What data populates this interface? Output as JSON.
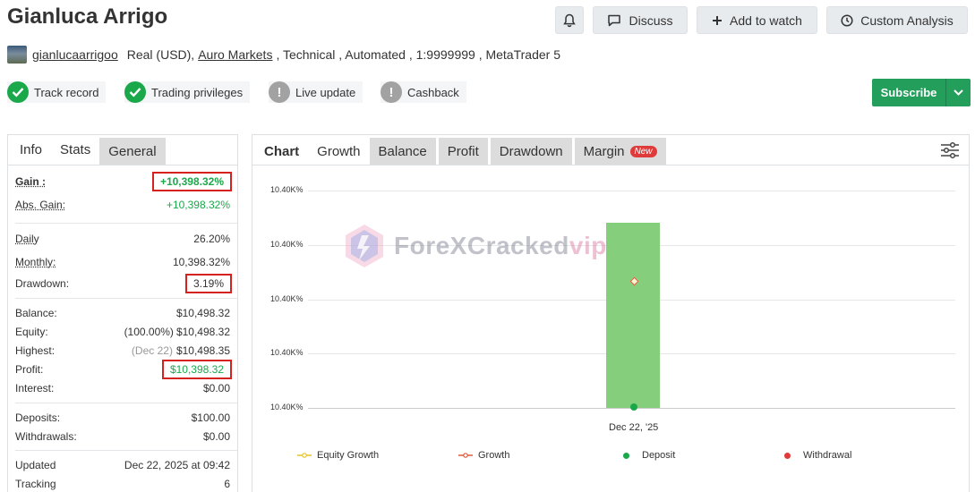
{
  "header": {
    "title": "Gianluca Arrigo",
    "buttons": {
      "discuss": "Discuss",
      "add_to_watch": "Add to watch",
      "custom_analysis": "Custom Analysis"
    }
  },
  "meta": {
    "username": "gianlucaarrigoo",
    "account_type": "Real (USD),",
    "broker": "Auro Markets",
    "rest": ", Technical , Automated , 1:9999999 , MetaTrader 5"
  },
  "badges": [
    {
      "label": "Track record",
      "status": "ok"
    },
    {
      "label": "Trading privileges",
      "status": "ok"
    },
    {
      "label": "Live update",
      "status": "warn"
    },
    {
      "label": "Cashback",
      "status": "warn"
    }
  ],
  "subscribe": {
    "label": "Subscribe"
  },
  "left_tabs": [
    "Info",
    "Stats",
    "General"
  ],
  "stats": {
    "gain": {
      "label": "Gain :",
      "value": "+10,398.32%"
    },
    "abs_gain": {
      "label": "Abs. Gain:",
      "value": "+10,398.32%"
    },
    "daily": {
      "label": "Daily",
      "value": "26.20%"
    },
    "monthly": {
      "label": "Monthly:",
      "value": "10,398.32%"
    },
    "drawdown": {
      "label": "Drawdown:",
      "value": "3.19%"
    },
    "balance": {
      "label": "Balance:",
      "value": "$10,498.32"
    },
    "equity": {
      "label": "Equity:",
      "pct": "(100.00%)",
      "value": "$10,498.32"
    },
    "highest": {
      "label": "Highest:",
      "date": "(Dec 22)",
      "value": "$10,498.35"
    },
    "profit": {
      "label": "Profit:",
      "value": "$10,398.32"
    },
    "interest": {
      "label": "Interest:",
      "value": "$0.00"
    },
    "deposits": {
      "label": "Deposits:",
      "value": "$100.00"
    },
    "withdrawals": {
      "label": "Withdrawals:",
      "value": "$0.00"
    },
    "updated": {
      "label": "Updated",
      "value": "Dec 22, 2025 at 09:42"
    },
    "tracking": {
      "label": "Tracking",
      "value": "6"
    }
  },
  "right_tabs": {
    "chart": "Chart",
    "growth": "Growth",
    "balance": "Balance",
    "profit": "Profit",
    "drawdown": "Drawdown",
    "margin": "Margin",
    "new_tag": "New"
  },
  "watermark": {
    "text": "ForeXCracked",
    "suffix": "vip"
  },
  "chart_data": {
    "type": "bar",
    "y_tick_labels": [
      "10.40K%",
      "10.40K%",
      "10.40K%",
      "10.40K%",
      "10.40K%"
    ],
    "categories": [
      "Dec 22, '25"
    ],
    "series": [
      {
        "name": "Equity Growth",
        "color": "#e6c229"
      },
      {
        "name": "Growth",
        "color": "#e05a3a"
      },
      {
        "name": "Deposit",
        "color": "#1aa84a"
      },
      {
        "name": "Withdrawal",
        "color": "#e03b3b"
      }
    ],
    "legend_position": "bottom"
  }
}
